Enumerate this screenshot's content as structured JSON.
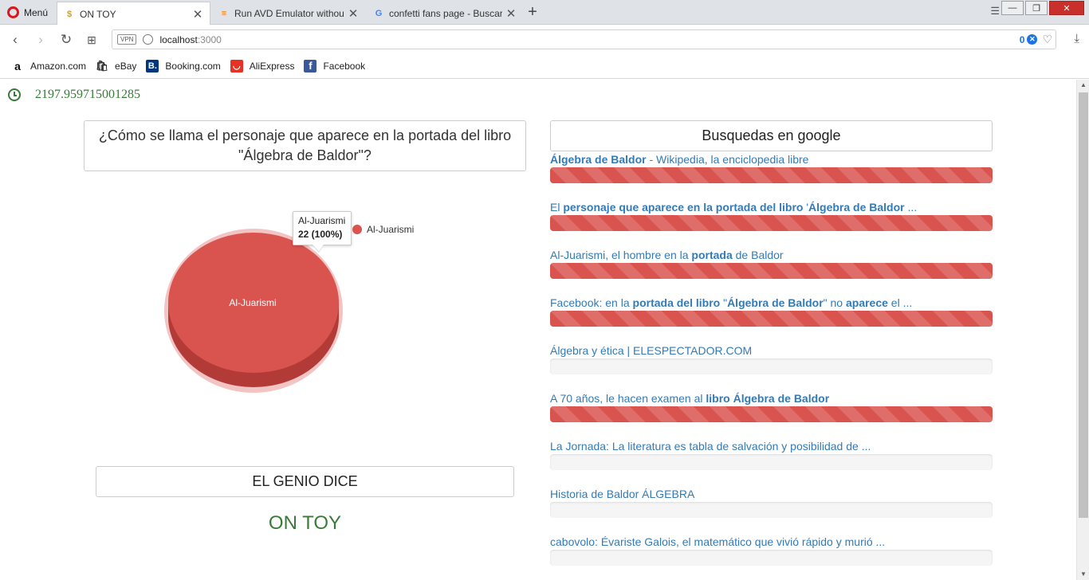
{
  "browser": {
    "menu_label": "Menú",
    "tabs": [
      {
        "title": "ON TOY",
        "favicon": "money-bag-icon",
        "active": true
      },
      {
        "title": "Run AVD Emulator without A",
        "favicon": "stackoverflow-icon",
        "active": false
      },
      {
        "title": "confetti fans page - Buscar c",
        "favicon": "google-icon",
        "active": false
      }
    ],
    "url_host": "localhost",
    "url_port": ":3000",
    "vpn_label": "VPN",
    "adblock_count": "0",
    "bookmarks": [
      {
        "label": "Amazon.com",
        "icon": "amazon-icon",
        "color": "#ffffff"
      },
      {
        "label": "eBay",
        "icon": "ebay-icon",
        "color": "#ffffff"
      },
      {
        "label": "Booking.com",
        "icon": "booking-icon",
        "color": "#003580"
      },
      {
        "label": "AliExpress",
        "icon": "aliexpress-icon",
        "color": "#e43225"
      },
      {
        "label": "Facebook",
        "icon": "facebook-icon",
        "color": "#3b5998"
      }
    ]
  },
  "page": {
    "timer_value": "2197.959715001285",
    "question": "¿Cómo se llama el personaje que aparece en la portada del libro \"Álgebra de Baldor\"?",
    "genio_label": "EL GENIO DICE",
    "answer": "ON TOY",
    "google_header": "Busquedas en google",
    "accent_color": "#d9534f",
    "answer_color": "#3a7a3a"
  },
  "chart_data": {
    "type": "pie",
    "series": [
      {
        "name": "Al-Juarismi",
        "values": [
          22
        ]
      }
    ],
    "categories": [
      "Al-Juarismi"
    ],
    "slice_labels": [
      "Al-Juarismi"
    ],
    "tooltip": {
      "title": "Al-Juarismi",
      "value_text": "22 (100%)"
    },
    "legend": {
      "placement": "right",
      "entries": [
        "Al-Juarismi"
      ]
    },
    "colors": [
      "#d9534f"
    ]
  },
  "results": [
    {
      "html": "<b>Álgebra de Baldor</b> - Wikipedia, la enciclopedia libre",
      "percent": 100
    },
    {
      "html": "El <b>personaje que aparece en la portada del libro</b> '<b>Álgebra de Baldor</b> ...",
      "percent": 100
    },
    {
      "html": "Al-Juarismi, el hombre en la <b>portada</b> de Baldor",
      "percent": 100
    },
    {
      "html": "Facebook: en la <b>portada del libro</b> \"<b>Álgebra de Baldor</b>\" no <b>aparece</b> el ...",
      "percent": 100
    },
    {
      "html": "Álgebra y ética | ELESPECTADOR.COM",
      "percent": 0
    },
    {
      "html": "A 70 años, le hacen examen al <b>libro Álgebra de Baldor</b>",
      "percent": 100
    },
    {
      "html": "La Jornada: La literatura es tabla de salvación y posibilidad de ...",
      "percent": 0
    },
    {
      "html": "Historia de Baldor ÁLGEBRA",
      "percent": 0
    },
    {
      "html": "cabovolo: Évariste Galois, el matemático que vivió rápido y murió ...",
      "percent": 0
    }
  ]
}
